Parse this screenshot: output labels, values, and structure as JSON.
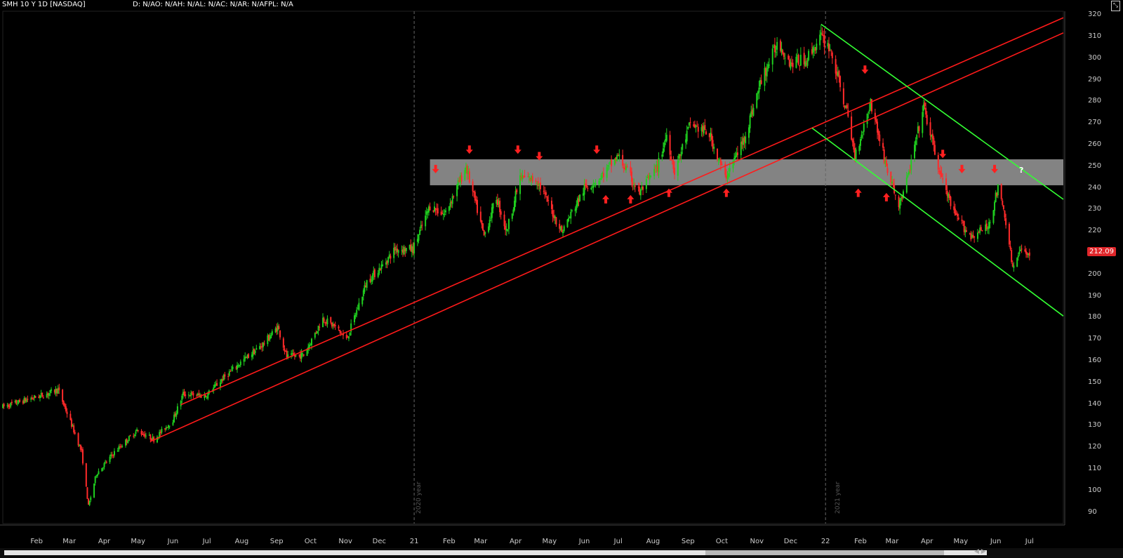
{
  "header": {
    "ticker": "SMH 10 Y 1D [NASDAQ]",
    "studies": "D: N/AO: N/AH: N/AL: N/AC: N/AR: N/AFPL: N/A",
    "corner_icon": "resize-icon"
  },
  "last_price": "212.09",
  "year_labels": [
    "2020 year",
    "2021 year"
  ],
  "question_mark": "?",
  "colors": {
    "up": "#1fcf1f",
    "down": "#ff2a2a",
    "trend_red": "#ff1a1a",
    "channel_green": "#33ff33",
    "zone": "#9a9a9a"
  },
  "chart_data": {
    "type": "candlestick",
    "title": "SMH 10 Y 1D [NASDAQ]",
    "ylim": [
      85,
      322
    ],
    "y_ticks": [
      90,
      100,
      110,
      120,
      130,
      140,
      150,
      160,
      170,
      180,
      190,
      200,
      210,
      220,
      230,
      240,
      250,
      260,
      270,
      280,
      290,
      300,
      310,
      320
    ],
    "x_tick_labels": [
      "Feb",
      "Mar",
      "Apr",
      "May",
      "Jun",
      "Jul",
      "Aug",
      "Sep",
      "Oct",
      "Nov",
      "Dec",
      "21",
      "Feb",
      "Mar",
      "Apr",
      "May",
      "Jun",
      "Jul",
      "Aug",
      "Sep",
      "Oct",
      "Nov",
      "Dec",
      "22",
      "Feb",
      "Mar",
      "Apr",
      "May",
      "Jun",
      "Jul"
    ],
    "x_tick_dates": [
      "2020-02-01",
      "2020-03-01",
      "2020-04-01",
      "2020-05-01",
      "2020-06-01",
      "2020-07-01",
      "2020-08-01",
      "2020-09-01",
      "2020-10-01",
      "2020-11-01",
      "2020-12-01",
      "2021-01-01",
      "2021-02-01",
      "2021-03-01",
      "2021-04-01",
      "2021-05-01",
      "2021-06-01",
      "2021-07-01",
      "2021-08-01",
      "2021-09-01",
      "2021-10-01",
      "2021-11-01",
      "2021-12-01",
      "2022-01-01",
      "2022-02-01",
      "2022-03-01",
      "2022-04-01",
      "2022-05-01",
      "2022-06-01",
      "2022-07-01"
    ],
    "date_range": [
      "2020-01-02",
      "2022-07-31"
    ],
    "price_path": [
      [
        "2020-01-02",
        139
      ],
      [
        "2020-02-10",
        145
      ],
      [
        "2020-02-20",
        147
      ],
      [
        "2020-03-05",
        128
      ],
      [
        "2020-03-12",
        118
      ],
      [
        "2020-03-18",
        93
      ],
      [
        "2020-03-25",
        108
      ],
      [
        "2020-04-10",
        118
      ],
      [
        "2020-04-30",
        128
      ],
      [
        "2020-05-15",
        124
      ],
      [
        "2020-06-01",
        133
      ],
      [
        "2020-06-10",
        145
      ],
      [
        "2020-06-30",
        144
      ],
      [
        "2020-07-15",
        152
      ],
      [
        "2020-08-01",
        160
      ],
      [
        "2020-08-20",
        168
      ],
      [
        "2020-09-02",
        176
      ],
      [
        "2020-09-10",
        162
      ],
      [
        "2020-09-25",
        163
      ],
      [
        "2020-10-12",
        180
      ],
      [
        "2020-10-25",
        175
      ],
      [
        "2020-11-02",
        170
      ],
      [
        "2020-11-20",
        197
      ],
      [
        "2020-12-05",
        205
      ],
      [
        "2020-12-15",
        212
      ],
      [
        "2020-12-31",
        212
      ],
      [
        "2021-01-15",
        232
      ],
      [
        "2021-01-28",
        228
      ],
      [
        "2021-02-16",
        250
      ],
      [
        "2021-03-04",
        218
      ],
      [
        "2021-03-15",
        236
      ],
      [
        "2021-03-24",
        220
      ],
      [
        "2021-04-05",
        245
      ],
      [
        "2021-04-20",
        244
      ],
      [
        "2021-05-12",
        220
      ],
      [
        "2021-06-01",
        240
      ],
      [
        "2021-06-15",
        245
      ],
      [
        "2021-07-01",
        255
      ],
      [
        "2021-07-20",
        238
      ],
      [
        "2021-08-05",
        250
      ],
      [
        "2021-08-13",
        265
      ],
      [
        "2021-08-20",
        248
      ],
      [
        "2021-09-03",
        270
      ],
      [
        "2021-09-20",
        265
      ],
      [
        "2021-10-04",
        245
      ],
      [
        "2021-10-20",
        262
      ],
      [
        "2021-11-05",
        290
      ],
      [
        "2021-11-20",
        308
      ],
      [
        "2021-12-01",
        298
      ],
      [
        "2021-12-15",
        300
      ],
      [
        "2021-12-28",
        310
      ],
      [
        "2022-01-05",
        305
      ],
      [
        "2022-01-20",
        275
      ],
      [
        "2022-01-27",
        255
      ],
      [
        "2022-02-10",
        280
      ],
      [
        "2022-02-24",
        250
      ],
      [
        "2022-03-07",
        232
      ],
      [
        "2022-03-15",
        245
      ],
      [
        "2022-03-29",
        278
      ],
      [
        "2022-04-12",
        248
      ],
      [
        "2022-04-25",
        228
      ],
      [
        "2022-05-10",
        218
      ],
      [
        "2022-05-25",
        222
      ],
      [
        "2022-06-03",
        240
      ],
      [
        "2022-06-10",
        225
      ],
      [
        "2022-06-16",
        203
      ],
      [
        "2022-06-24",
        212
      ],
      [
        "2022-07-01",
        210
      ]
    ],
    "support_resistance_zone": {
      "low": 241.5,
      "high": 253.5,
      "start": "2021-01-15",
      "end": "2022-07-31"
    },
    "trendlines": [
      {
        "name": "",
        "color": "red",
        "start": [
          "2020-06-08",
          140
        ],
        "end": [
          "2022-07-31",
          319
        ]
      },
      {
        "name": "",
        "color": "red",
        "start": [
          "2020-05-12",
          123
        ],
        "end": [
          "2022-07-31",
          312
        ]
      },
      {
        "name": "",
        "color": "green",
        "start": [
          "2021-12-28",
          316
        ],
        "end": [
          "2022-07-31",
          235
        ]
      },
      {
        "name": "",
        "color": "green",
        "start": [
          "2021-12-20",
          268
        ],
        "end": [
          "2022-07-31",
          181
        ]
      }
    ],
    "arrows_down": [
      [
        "2021-01-20",
        248
      ],
      [
        "2021-02-19",
        257
      ],
      [
        "2021-04-03",
        257
      ],
      [
        "2021-04-22",
        254
      ],
      [
        "2021-06-12",
        257
      ],
      [
        "2022-02-05",
        294
      ],
      [
        "2022-04-15",
        255
      ],
      [
        "2022-05-02",
        248
      ],
      [
        "2022-05-31",
        248
      ]
    ],
    "arrows_up": [
      [
        "2021-06-20",
        236
      ],
      [
        "2021-07-12",
        236
      ],
      [
        "2021-08-15",
        239
      ],
      [
        "2021-10-05",
        239
      ],
      [
        "2022-01-30",
        239
      ],
      [
        "2022-02-24",
        237
      ]
    ],
    "year_separators": [
      "2021-01-01",
      "2022-01-01"
    ]
  }
}
